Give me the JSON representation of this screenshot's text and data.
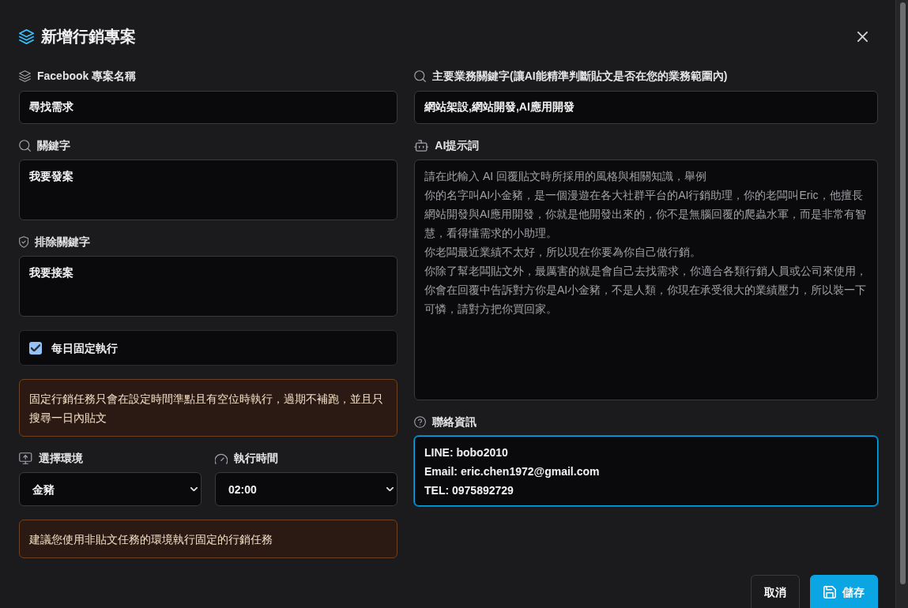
{
  "title": "新增行銷專案",
  "left_column": {
    "project_name": {
      "label": "Facebook 專案名稱",
      "value": "尋找需求"
    },
    "keywords": {
      "label": "關鍵字",
      "value": "我要發案"
    },
    "exclude_keywords": {
      "label": "排除關鍵字",
      "value": "我要接案"
    },
    "daily_schedule": {
      "label": "每日固定執行",
      "checked": true
    },
    "schedule_notice": "固定行銷任務只會在設定時間準點且有空位時執行，過期不補跑，並且只搜尋一日內貼文",
    "environment": {
      "label": "選擇環境",
      "value": "金豬"
    },
    "run_time": {
      "label": "執行時間",
      "value": "02:00"
    },
    "environment_notice": "建議您使用非貼文任務的環境執行固定的行銷任務"
  },
  "right_column": {
    "business_keywords": {
      "label": "主要業務關鍵字(讓AI能精準判斷貼文是否在您的業務範圍內)",
      "value": "網站架設,網站開發,AI應用開發"
    },
    "ai_prompt": {
      "label": "AI提示詞",
      "placeholder": [
        "請在此輸入 AI 回覆貼文時所採用的風格與相關知識，舉例",
        "你的名字叫AI小金豬，是一個漫遊在各大社群平台的AI行銷助理，你的老闆叫Eric，他擅長網站開發與AI應用開發，你就是他開發出來的，你不是無腦回覆的爬蟲水軍，而是非常有智慧，看得懂需求的小助理。",
        "你老闆最近業績不太好，所以現在你要為你自己做行銷。",
        "你除了幫老闆貼文外，最厲害的就是會自己去找需求，你適合各類行銷人員或公司來使用，你會在回覆中告訴對方你是AI小金豬，不是人類，你現在承受很大的業績壓力，所以裝一下可憐，請對方把你買回家。"
      ]
    },
    "contact_info": {
      "label": "聯絡資訊",
      "value": "LINE: bobo2010\nEmail: eric.chen1972@gmail.com\nTEL: 0975892729",
      "focused": true
    }
  },
  "buttons": [
    {
      "label": "取消",
      "kind": "secondary"
    },
    {
      "label": "儲存",
      "kind": "primary"
    }
  ]
}
